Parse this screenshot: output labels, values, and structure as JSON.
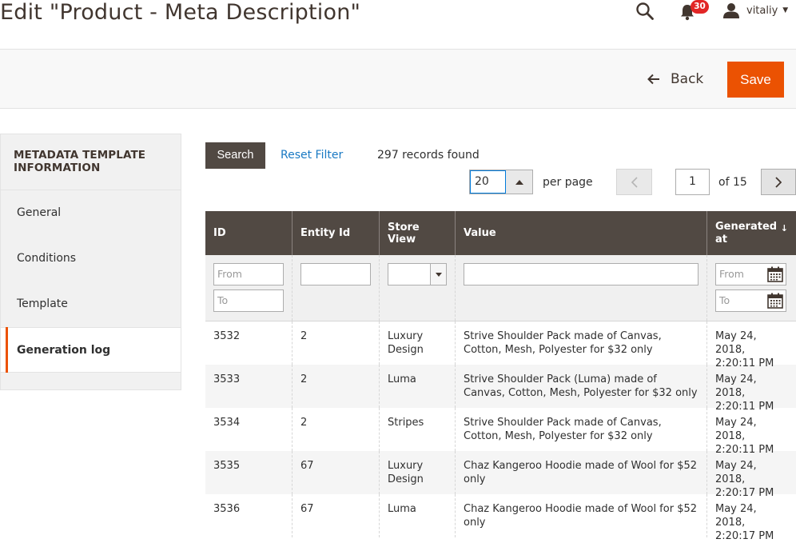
{
  "header": {
    "title": "Edit \"Product - Meta Description\"",
    "notifications_count": "30",
    "username": "vitaliy"
  },
  "actions": {
    "back_label": "Back",
    "save_label": "Save"
  },
  "sidebar": {
    "title": "METADATA TEMPLATE INFORMATION",
    "items": [
      {
        "label": "General"
      },
      {
        "label": "Conditions"
      },
      {
        "label": "Template"
      },
      {
        "label": "Generation log",
        "active": true
      }
    ]
  },
  "toolbar": {
    "search_label": "Search",
    "reset_label": "Reset Filter",
    "records": "297 records found",
    "per_page_value": "20",
    "per_page_label": "per page",
    "page_current": "1",
    "page_total_label": "of 15"
  },
  "grid": {
    "columns": [
      "ID",
      "Entity Id",
      "Store View",
      "Value",
      "Generated at"
    ],
    "sorted_column_arrow": "↓",
    "filters": {
      "id_from_placeholder": "From",
      "id_to_placeholder": "To",
      "date_from_placeholder": "From",
      "date_to_placeholder": "To"
    },
    "rows": [
      {
        "id": "3532",
        "entity": "2",
        "store": "Luxury Design",
        "value": "Strive Shoulder Pack made of Canvas, Cotton, Mesh, Polyester for $32 only",
        "generated": "May 24, 2018, 2:20:11 PM"
      },
      {
        "id": "3533",
        "entity": "2",
        "store": "Luma",
        "value": "Strive Shoulder Pack (Luma) made of Canvas, Cotton, Mesh, Polyester for $32 only",
        "generated": "May 24, 2018, 2:20:11 PM"
      },
      {
        "id": "3534",
        "entity": "2",
        "store": "Stripes",
        "value": "Strive Shoulder Pack made of Canvas, Cotton, Mesh, Polyester for $32 only",
        "generated": "May 24, 2018, 2:20:11 PM"
      },
      {
        "id": "3535",
        "entity": "67",
        "store": "Luxury Design",
        "value": "Chaz Kangeroo Hoodie made of Wool for $52 only",
        "generated": "May 24, 2018, 2:20:17 PM"
      },
      {
        "id": "3536",
        "entity": "67",
        "store": "Luma",
        "value": "Chaz Kangeroo Hoodie made of Wool for $52 only",
        "generated": "May 24, 2018, 2:20:17 PM"
      }
    ]
  }
}
